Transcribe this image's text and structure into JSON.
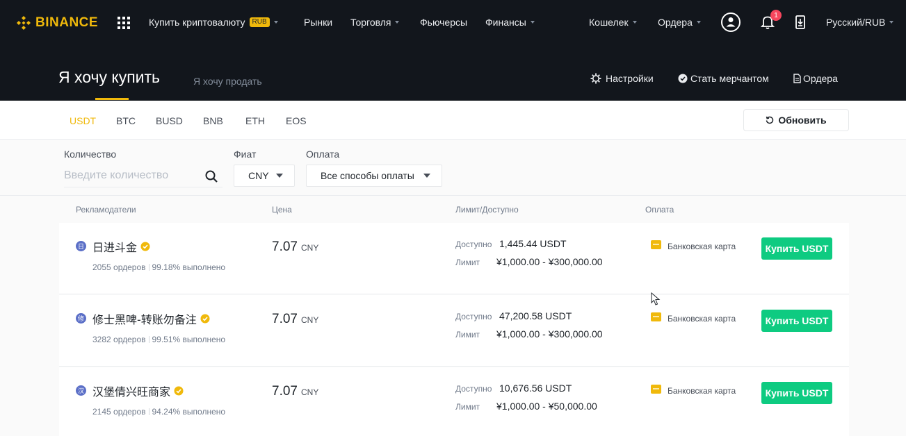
{
  "nav": {
    "logo": "BINANCE",
    "items": [
      {
        "label": "Купить криптовалюту",
        "badge": "RUB"
      },
      {
        "label": "Рынки"
      },
      {
        "label": "Торговля"
      },
      {
        "label": "Фьючерсы"
      },
      {
        "label": "Финансы"
      },
      {
        "label": "Кошелек"
      },
      {
        "label": "Ордера"
      },
      {
        "label": "Русский/RUB"
      }
    ],
    "notifications_count": "1"
  },
  "hero": {
    "buy_title": "Я хочу купить",
    "sell_tab": "Я хочу продать",
    "actions": [
      "Настройки",
      "Стать мерчантом",
      "Ордера"
    ]
  },
  "assets": {
    "tabs": [
      "USDT",
      "BTC",
      "BUSD",
      "BNB",
      "ETH",
      "EOS"
    ],
    "active": "USDT",
    "refresh_label": "Обновить"
  },
  "filters": {
    "amount_label": "Количество",
    "amount_placeholder": "Введите количество",
    "fiat_label": "Фиат",
    "fiat_value": "CNY",
    "payment_label": "Оплата",
    "payment_value": "Все способы оплаты"
  },
  "table": {
    "headers": [
      "Рекламодатели",
      "Цена",
      "Лимит/Доступно",
      "Оплата"
    ],
    "available_label": "Доступно",
    "limit_label": "Лимит",
    "rows": [
      {
        "avatar": "日",
        "name": "日进斗金",
        "orders": "2055 ордеров",
        "completion": "99.18% выполнено",
        "price": "7.07",
        "currency": "CNY",
        "available": "1,445.44 USDT",
        "limit": "¥1,000.00 - ¥300,000.00",
        "payment": "Банковская карта",
        "button": "Купить USDT"
      },
      {
        "avatar": "修",
        "name": "修士黑啤-转账勿备注",
        "orders": "3282 ордеров",
        "completion": "99.51% выполнено",
        "price": "7.07",
        "currency": "CNY",
        "available": "47,200.58 USDT",
        "limit": "¥1,000.00 - ¥300,000.00",
        "payment": "Банковская карта",
        "button": "Купить USDT"
      },
      {
        "avatar": "汉",
        "name": "汉堡倩兴旺商家",
        "orders": "2145 ордеров",
        "completion": "94.24% выполнено",
        "price": "7.07",
        "currency": "CNY",
        "available": "10,676.56 USDT",
        "limit": "¥1,000.00 - ¥50,000.00",
        "payment": "Банковская карта",
        "button": "Купить USDT"
      }
    ]
  },
  "colors": {
    "brand": "#f0b90b",
    "buy": "#0ecb81",
    "nav_bg": "#12161c",
    "alert": "#f6465d"
  }
}
